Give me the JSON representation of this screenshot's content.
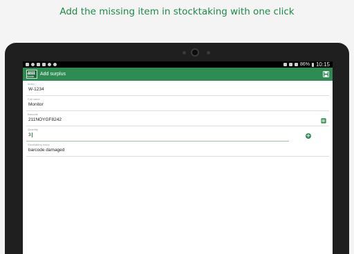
{
  "headline": "Add the missing item in stocktaking with one click",
  "status_bar": {
    "battery": "86%",
    "time": "10:15"
  },
  "app_bar": {
    "logo_text": "STOCK Mobile",
    "title": "Add surplus",
    "save_icon": "save-icon"
  },
  "form": {
    "fields": [
      {
        "label": "Index",
        "value": "W-1234"
      },
      {
        "label": "Full name",
        "value": "Monitor"
      },
      {
        "label": "Barcode",
        "value": "211NOYGF8242"
      },
      {
        "label": "Quantity",
        "value": "3"
      },
      {
        "label": "Stocktaking notes",
        "value": "barcode damaged"
      }
    ]
  },
  "colors": {
    "accent": "#2e8b52",
    "headline": "#1e8a4a",
    "tablet": "#1f1f1f"
  }
}
